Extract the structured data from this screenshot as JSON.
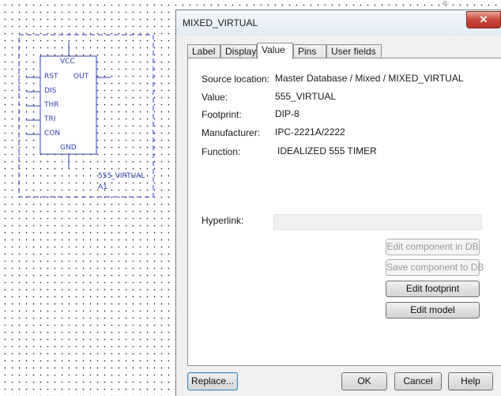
{
  "schematic": {
    "pins_left": [
      "RST",
      "DIS",
      "THR",
      "TRI",
      "CON"
    ],
    "pin_top": "VCC",
    "pin_bottom": "GND",
    "pin_right": "OUT",
    "part_value": "555_VIRTUAL",
    "ref_des": "A1"
  },
  "behind_window_glyph": "-8-",
  "dialog": {
    "title": "MIXED_VIRTUAL",
    "close_glyph": "✕",
    "tabs": [
      "Label",
      "Display",
      "Value",
      "Pins",
      "User fields"
    ],
    "active_tab": "Value",
    "fields": {
      "source_location": {
        "label": "Source location:",
        "value": "Master Database / Mixed / MIXED_VIRTUAL"
      },
      "value": {
        "label": "Value:",
        "value": "555_VIRTUAL"
      },
      "footprint": {
        "label": "Footprint:",
        "value": "DIP-8"
      },
      "manufacturer": {
        "label": "Manufacturer:",
        "value": "IPC-2221A/2222"
      },
      "function": {
        "label": "Function:",
        "value": "IDEALIZED 555 TIMER"
      },
      "hyperlink": {
        "label": "Hyperlink:",
        "value": ""
      }
    },
    "panel_buttons": {
      "edit_component": "Edit component in DB",
      "save_component": "Save component to DB",
      "edit_footprint": "Edit footprint",
      "edit_model": "Edit model"
    },
    "bottom_buttons": {
      "replace": "Replace...",
      "ok": "OK",
      "cancel": "Cancel",
      "help": "Help"
    }
  }
}
